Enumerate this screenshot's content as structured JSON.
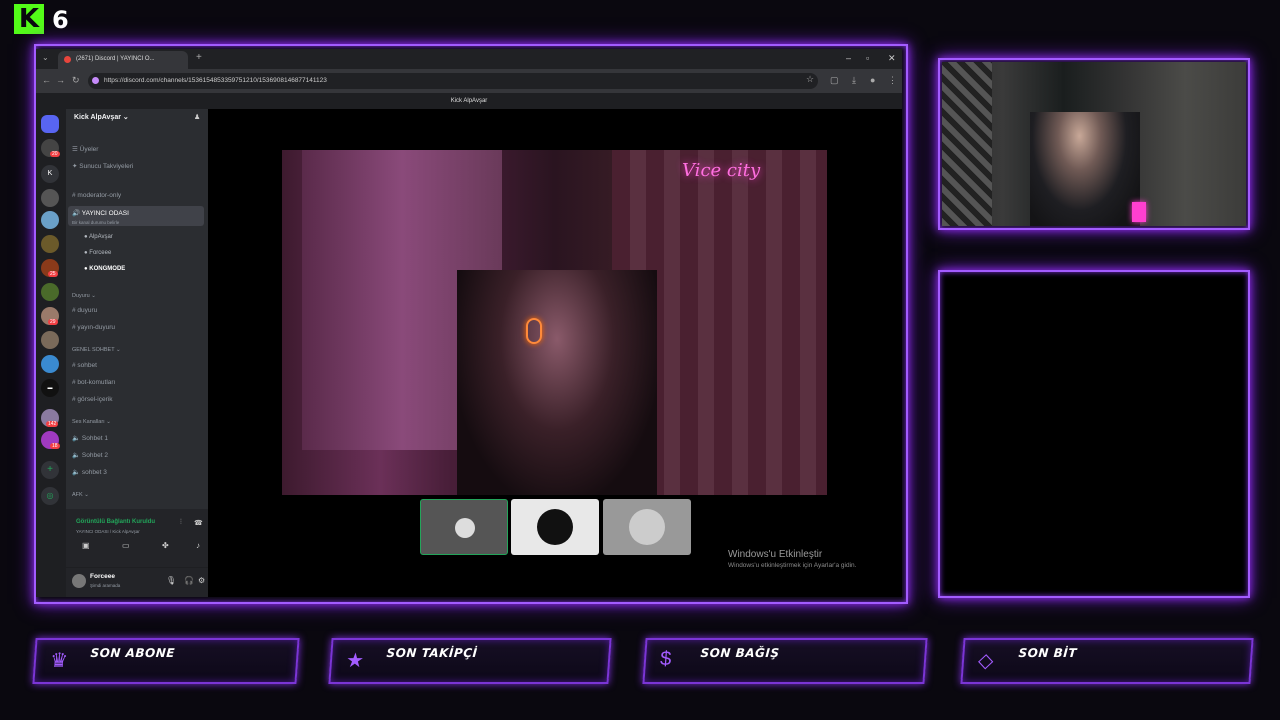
{
  "logo": {
    "letter": "K",
    "number": "6"
  },
  "browser": {
    "tab_title": "(2671) Discord | YAYINCI O...",
    "url": "https://discord.com/channels/1536154853359751210/1536908146877141123",
    "window_title": "Kick AlpAvşar"
  },
  "discord": {
    "server_name": "Kick AlpAvşar",
    "channels_top": [
      "Üyeler",
      "Sunucu Takviyeleri",
      "moderator-only"
    ],
    "active_channel": "YAYINCI ODASI",
    "active_status": "Bir kanal durumu belirle",
    "voice_users": [
      "AlpAvşar",
      "Forceee",
      "KONGMODE"
    ],
    "cat_duyuru": "Duyuru",
    "duyuru_channels": [
      "duyuru",
      "yayın-duyuru"
    ],
    "cat_genel": "GENEL SOHBET",
    "genel_channels": [
      "sohbet",
      "bot-komutları",
      "görsel-içerik"
    ],
    "cat_ses": "Ses Kanalları",
    "ses_channels": [
      "Sohbet 1",
      "Sohbet 2",
      "sohbet 3"
    ],
    "cat_afk": "AFK",
    "voice_connected": "Görüntülü Bağlantı Kuruldu",
    "voice_sub": "YAYINCI ODASI / Kick AlpAvşar",
    "username": "Forceee",
    "user_status": "Şimdi aramada",
    "server_badges": [
      "20",
      "1",
      "25",
      "29",
      "142",
      "18"
    ]
  },
  "stage": {
    "watermark_title": "Windows'u Etkinleştir",
    "watermark_sub": "Windows'u etkinleştirmek için Ayarlar'a gidin.",
    "neon_text": "Vice city"
  },
  "panels": [
    {
      "label": "SON ABONE",
      "icon": "crown-icon"
    },
    {
      "label": "SON TAKİPÇİ",
      "icon": "star-icon"
    },
    {
      "label": "SON BAĞIŞ",
      "icon": "dollar-icon"
    },
    {
      "label": "SON BİT",
      "icon": "diamond-icon"
    }
  ],
  "colors": {
    "accent": "#a35cff",
    "kick_green": "#53fc18",
    "discord_green": "#23a55a"
  }
}
